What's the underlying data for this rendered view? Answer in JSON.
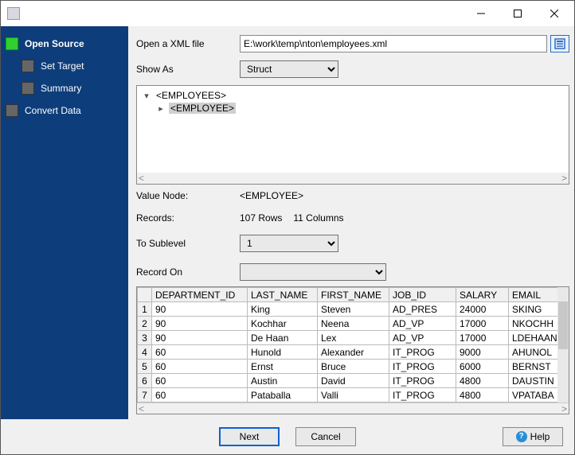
{
  "sidebar": {
    "items": [
      {
        "label": "Open Source",
        "active": true,
        "child": false
      },
      {
        "label": "Set Target",
        "active": false,
        "child": true
      },
      {
        "label": "Summary",
        "active": false,
        "child": true
      },
      {
        "label": "Convert Data",
        "active": false,
        "child": false
      }
    ]
  },
  "form": {
    "open_label": "Open a XML file",
    "file_value": "E:\\work\\temp\\nton\\employees.xml",
    "show_as_label": "Show As",
    "show_as_value": "Struct"
  },
  "tree": {
    "root": "<EMPLOYEES>",
    "child": "<EMPLOYEE>"
  },
  "meta": {
    "value_node_label": "Value Node:",
    "value_node": "<EMPLOYEE>",
    "records_label": "Records:",
    "records_rows": "107 Rows",
    "records_cols": "11 Columns",
    "to_sublevel_label": "To Sublevel",
    "to_sublevel_value": "1",
    "record_on_label": "Record On",
    "record_on_value": ""
  },
  "grid": {
    "columns": [
      "DEPARTMENT_ID",
      "LAST_NAME",
      "FIRST_NAME",
      "JOB_ID",
      "SALARY",
      "EMAIL"
    ],
    "rows": [
      [
        "90",
        "King",
        "Steven",
        "AD_PRES",
        "24000",
        "SKING"
      ],
      [
        "90",
        "Kochhar",
        "Neena",
        "AD_VP",
        "17000",
        "NKOCHH"
      ],
      [
        "90",
        "De Haan",
        "Lex",
        "AD_VP",
        "17000",
        "LDEHAAN"
      ],
      [
        "60",
        "Hunold",
        "Alexander",
        "IT_PROG",
        "9000",
        "AHUNOL"
      ],
      [
        "60",
        "Ernst",
        "Bruce",
        "IT_PROG",
        "6000",
        "BERNST"
      ],
      [
        "60",
        "Austin",
        "David",
        "IT_PROG",
        "4800",
        "DAUSTIN"
      ],
      [
        "60",
        "Pataballa",
        "Valli",
        "IT_PROG",
        "4800",
        "VPATABA"
      ]
    ]
  },
  "footer": {
    "next": "Next",
    "cancel": "Cancel",
    "help": "Help"
  }
}
